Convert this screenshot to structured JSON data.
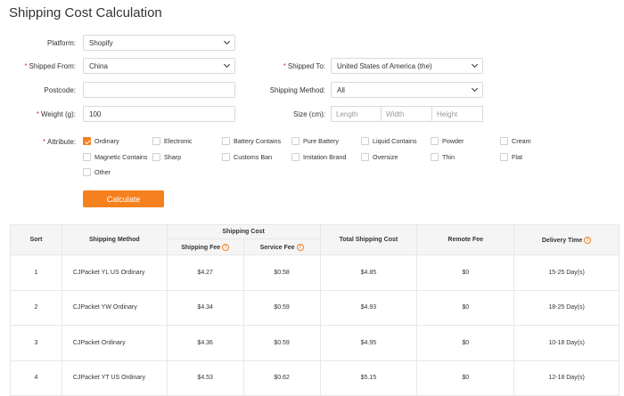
{
  "page": {
    "title": "Shipping Cost Calculation"
  },
  "form": {
    "platform": {
      "label": "Platform:",
      "value": "Shopify"
    },
    "shipped_from": {
      "label": "Shipped From:",
      "value": "China"
    },
    "shipped_to": {
      "label": "Shipped To:",
      "value": "United States of America (the)"
    },
    "postcode": {
      "label": "Postcode:",
      "value": ""
    },
    "shipping_method": {
      "label": "Shipping Method:",
      "value": "All"
    },
    "weight": {
      "label": "Weight (g):",
      "value": "100"
    },
    "size": {
      "label": "Size (cm):",
      "length_placeholder": "Length",
      "width_placeholder": "Width",
      "height_placeholder": "Height"
    },
    "attribute": {
      "label": "Attribute:",
      "options": [
        {
          "label": "Ordinary",
          "checked": true
        },
        {
          "label": "Electronic",
          "checked": false
        },
        {
          "label": "Battery Contains",
          "checked": false
        },
        {
          "label": "Pure Battery",
          "checked": false
        },
        {
          "label": "Liquid Contains",
          "checked": false
        },
        {
          "label": "Powder",
          "checked": false
        },
        {
          "label": "Cream",
          "checked": false
        },
        {
          "label": "Magnetic Contains",
          "checked": false
        },
        {
          "label": "Sharp",
          "checked": false
        },
        {
          "label": "Customs Ban",
          "checked": false
        },
        {
          "label": "Imitation Brand",
          "checked": false
        },
        {
          "label": "Oversize",
          "checked": false
        },
        {
          "label": "Thin",
          "checked": false
        },
        {
          "label": "Flat",
          "checked": false
        },
        {
          "label": "Other",
          "checked": false
        }
      ]
    },
    "calculate_label": "Calculate",
    "accent_color": "#f5811e"
  },
  "table": {
    "headers": {
      "sort": "Sort",
      "method": "Shipping Method",
      "shipping_cost": "Shipping Cost",
      "shipping_fee": "Shipping Fee",
      "service_fee": "Service Fee",
      "total": "Total Shipping Cost",
      "remote": "Remote Fee",
      "delivery": "Delivery Time"
    },
    "rows": [
      {
        "sort": "1",
        "method": "CJPacket YL US Ordinary",
        "shipping_fee": "$4.27",
        "service_fee": "$0.58",
        "total": "$4.85",
        "remote": "$0",
        "delivery": "15-25 Day(s)"
      },
      {
        "sort": "2",
        "method": "CJPacket YW Ordinary",
        "shipping_fee": "$4.34",
        "service_fee": "$0.59",
        "total": "$4.93",
        "remote": "$0",
        "delivery": "18-25 Day(s)"
      },
      {
        "sort": "3",
        "method": "CJPacket Ordinary",
        "shipping_fee": "$4.36",
        "service_fee": "$0.59",
        "total": "$4.95",
        "remote": "$0",
        "delivery": "10-18 Day(s)"
      },
      {
        "sort": "4",
        "method": "CJPacket YT US Ordinary",
        "shipping_fee": "$4.53",
        "service_fee": "$0.62",
        "total": "$5.15",
        "remote": "$0",
        "delivery": "12-18 Day(s)"
      }
    ]
  }
}
